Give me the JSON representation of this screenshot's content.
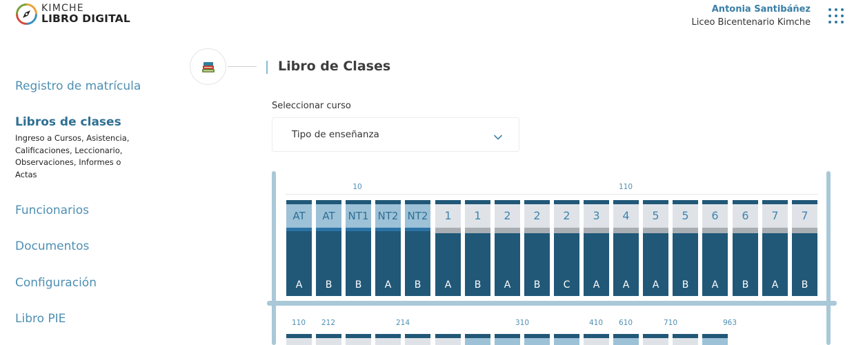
{
  "brand": {
    "line1": "KIMCHE",
    "line2": "LIBRO DIGITAL"
  },
  "user": {
    "name": "Antonia Santibáñez",
    "school": "Liceo Bicentenario Kimche"
  },
  "sidebar": {
    "items": [
      {
        "label": "Registro de matrícula"
      },
      {
        "label": "Libros de clases",
        "active": true
      },
      {
        "label": "Funcionarios"
      },
      {
        "label": "Documentos"
      },
      {
        "label": "Configuración"
      },
      {
        "label": "Libro PIE"
      }
    ],
    "active_description": "Ingreso a Cursos, Asistencia, Calificaciones, Leccionario, Observaciones, Informes o Actas"
  },
  "page": {
    "title": "Libro de Clases"
  },
  "course_select": {
    "label": "Seleccionar curso",
    "value": "Tipo de enseñanza"
  },
  "shelf1": {
    "rooms": [
      "10",
      "110"
    ],
    "books": [
      {
        "level": "AT",
        "section": "A",
        "type": "pre"
      },
      {
        "level": "AT",
        "section": "B",
        "type": "pre"
      },
      {
        "level": "NT1",
        "section": "B",
        "type": "pre"
      },
      {
        "level": "NT2",
        "section": "A",
        "type": "pre"
      },
      {
        "level": "NT2",
        "section": "B",
        "type": "pre"
      },
      {
        "level": "1",
        "section": "A",
        "type": "basic"
      },
      {
        "level": "1",
        "section": "B",
        "type": "basic"
      },
      {
        "level": "2",
        "section": "A",
        "type": "basic"
      },
      {
        "level": "2",
        "section": "B",
        "type": "basic"
      },
      {
        "level": "2",
        "section": "C",
        "type": "basic"
      },
      {
        "level": "3",
        "section": "A",
        "type": "basic"
      },
      {
        "level": "4",
        "section": "A",
        "type": "basic"
      },
      {
        "level": "5",
        "section": "A",
        "type": "basic"
      },
      {
        "level": "5",
        "section": "B",
        "type": "basic"
      },
      {
        "level": "6",
        "section": "A",
        "type": "basic"
      },
      {
        "level": "6",
        "section": "B",
        "type": "basic"
      },
      {
        "level": "7",
        "section": "A",
        "type": "basic"
      },
      {
        "level": "7",
        "section": "B",
        "type": "basic"
      }
    ]
  },
  "shelf2": {
    "rooms": [
      "110",
      "212",
      "214",
      "310",
      "410",
      "610",
      "710",
      "963"
    ],
    "book_styles": [
      "basic",
      "basic",
      "basic",
      "basic",
      "basic",
      "basic",
      "pre",
      "pre",
      "pre",
      "pre",
      "basic",
      "pre",
      "basic",
      "basic",
      "pre"
    ]
  },
  "colors": {
    "accent": "#4e8fb3",
    "book_dark": "#215878",
    "band_light": "#dfe3e8",
    "band_pre": "#9dc1d7",
    "shelf": "#a9c8d8"
  }
}
